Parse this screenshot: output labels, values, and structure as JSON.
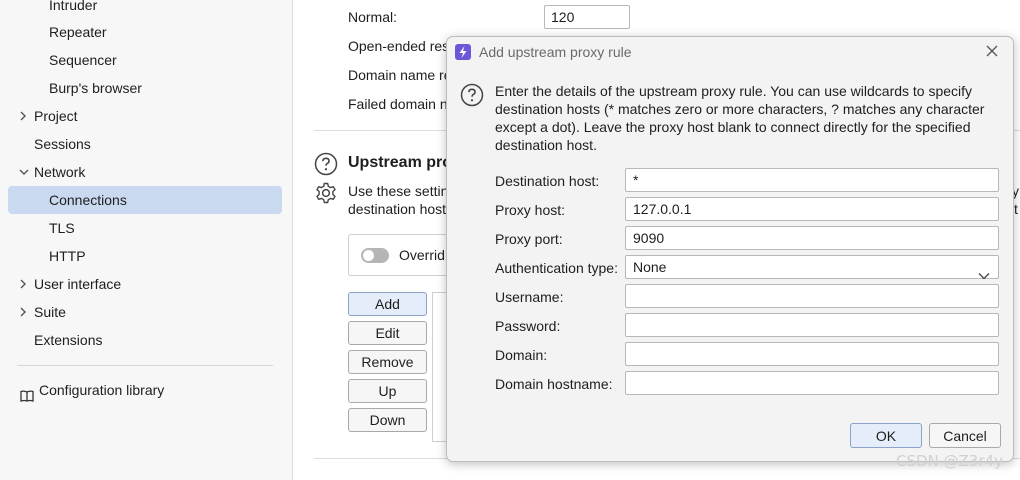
{
  "sidebar": {
    "items": [
      {
        "label": "Intruder"
      },
      {
        "label": "Repeater"
      },
      {
        "label": "Sequencer"
      },
      {
        "label": "Burp's browser"
      },
      {
        "label": "Project"
      },
      {
        "label": "Sessions"
      },
      {
        "label": "Network"
      },
      {
        "label": "Connections"
      },
      {
        "label": "TLS"
      },
      {
        "label": "HTTP"
      },
      {
        "label": "User interface"
      },
      {
        "label": "Suite"
      },
      {
        "label": "Extensions"
      }
    ],
    "config_library": "Configuration library"
  },
  "main": {
    "timeouts": {
      "normal_label": "Normal:",
      "normal_value": "120",
      "open_ended_label": "Open-ended res",
      "domain_name_label": "Domain name re",
      "failed_domain_label": "Failed domain n"
    },
    "upstream": {
      "title": "Upstream pro",
      "desc_line1": "Use these settin",
      "desc_line2": "destination host",
      "trailing_1": "y",
      "trailing_2": "t",
      "override_label": "Overrid"
    },
    "buttons": {
      "add": "Add",
      "edit": "Edit",
      "remove": "Remove",
      "up": "Up",
      "down": "Down"
    }
  },
  "dialog": {
    "title": "Add upstream proxy rule",
    "description": "Enter the details of the upstream proxy rule. You can use wildcards to specify destination hosts (* matches zero or more characters, ? matches any character except a dot). Leave the proxy host blank to connect directly for the specified destination host.",
    "fields": {
      "destination_host": {
        "label": "Destination host:",
        "value": "*"
      },
      "proxy_host": {
        "label": "Proxy host:",
        "value": "127.0.0.1"
      },
      "proxy_port": {
        "label": "Proxy port:",
        "value": "9090"
      },
      "auth_type": {
        "label": "Authentication type:",
        "value": "None"
      },
      "username": {
        "label": "Username:",
        "value": ""
      },
      "password": {
        "label": "Password:",
        "value": ""
      },
      "domain": {
        "label": "Domain:",
        "value": ""
      },
      "domain_hostname": {
        "label": "Domain hostname:",
        "value": ""
      }
    },
    "ok_label": "OK",
    "cancel_label": "Cancel"
  },
  "watermark": "CSDN @Z3r4y",
  "colors": {
    "selected_nav": "#c9daf0",
    "logo": "#6b58d6",
    "sidebar_bg": "#f7f7f7",
    "dialog_bg": "#f3f3f3"
  }
}
